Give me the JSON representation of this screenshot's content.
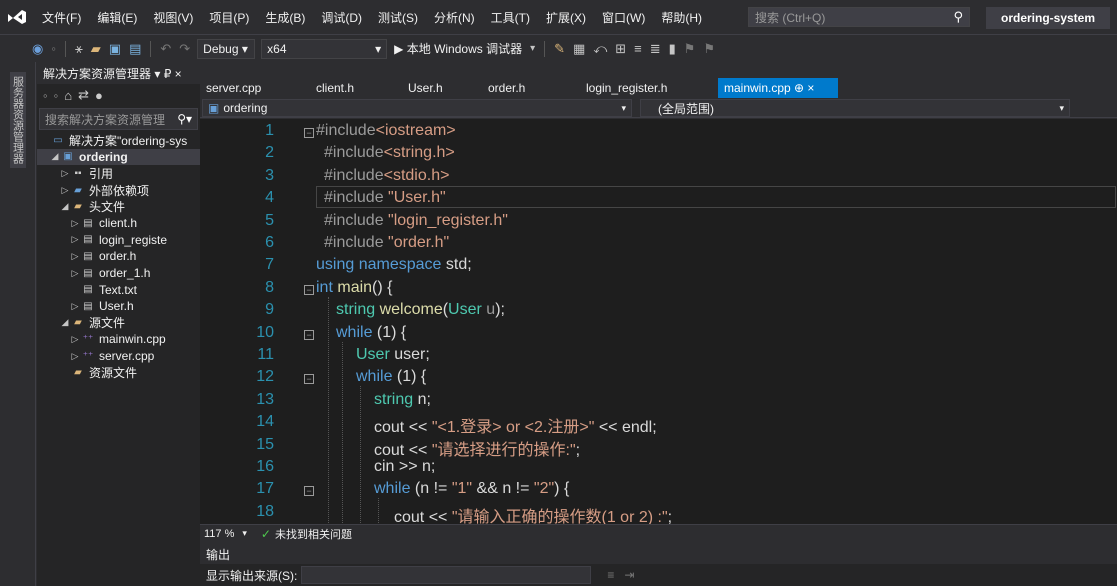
{
  "menubar": {
    "items": [
      "文件(F)",
      "编辑(E)",
      "视图(V)",
      "项目(P)",
      "生成(B)",
      "调试(D)",
      "测试(S)",
      "分析(N)",
      "工具(T)",
      "扩展(X)",
      "窗口(W)",
      "帮助(H)"
    ],
    "search_placeholder": "搜索 (Ctrl+Q)",
    "project_name": "ordering-system"
  },
  "toolbar": {
    "config": "Debug",
    "platform": "x64",
    "run_label": "▶ 本地 Windows 调试器"
  },
  "sidestrip": {
    "label": "服务器资源管理器"
  },
  "solution_explorer": {
    "title": "解决方案资源管理器 ▾ ₽ ×",
    "search_placeholder": "搜索解决方案资源管理",
    "items": [
      {
        "label": "解决方案\"ordering-sys",
        "indent": 0,
        "arrow": "",
        "icon": "solution-icon",
        "selected": false
      },
      {
        "label": "ordering",
        "indent": 1,
        "arrow": "◢",
        "icon": "project-icon",
        "selected": true
      },
      {
        "label": "引用",
        "indent": 2,
        "arrow": "▷",
        "icon": "references-icon",
        "selected": false
      },
      {
        "label": "外部依赖项",
        "indent": 2,
        "arrow": "▷",
        "icon": "external-deps-icon",
        "selected": false
      },
      {
        "label": "头文件",
        "indent": 2,
        "arrow": "◢",
        "icon": "folder-icon",
        "selected": false
      },
      {
        "label": "client.h",
        "indent": 3,
        "arrow": "▷",
        "icon": "header-file-icon",
        "selected": false
      },
      {
        "label": "login_registe",
        "indent": 3,
        "arrow": "▷",
        "icon": "header-file-icon",
        "selected": false
      },
      {
        "label": "order.h",
        "indent": 3,
        "arrow": "▷",
        "icon": "header-file-icon",
        "selected": false
      },
      {
        "label": "order_1.h",
        "indent": 3,
        "arrow": "▷",
        "icon": "header-file-icon",
        "selected": false
      },
      {
        "label": "Text.txt",
        "indent": 3,
        "arrow": "",
        "icon": "text-file-icon",
        "selected": false
      },
      {
        "label": "User.h",
        "indent": 3,
        "arrow": "▷",
        "icon": "header-file-icon",
        "selected": false
      },
      {
        "label": "源文件",
        "indent": 2,
        "arrow": "◢",
        "icon": "folder-icon",
        "selected": false
      },
      {
        "label": "mainwin.cpp",
        "indent": 3,
        "arrow": "▷",
        "icon": "cpp-file-icon",
        "selected": false
      },
      {
        "label": "server.cpp",
        "indent": 3,
        "arrow": "▷",
        "icon": "cpp-file-icon",
        "selected": false
      },
      {
        "label": "资源文件",
        "indent": 2,
        "arrow": "",
        "icon": "folder-icon",
        "selected": false
      }
    ]
  },
  "tabs": [
    {
      "label": "server.cpp",
      "active": false
    },
    {
      "label": "client.h",
      "active": false
    },
    {
      "label": "User.h",
      "active": false
    },
    {
      "label": "order.h",
      "active": false
    },
    {
      "label": "login_register.h",
      "active": false
    },
    {
      "label": "mainwin.cpp  ⊕  ×",
      "active": true
    }
  ],
  "navbar": {
    "project": "ordering",
    "scope": "(全局范围)"
  },
  "editor": {
    "lines": [
      {
        "n": "1",
        "tokens": [
          [
            "pp",
            "#include"
          ],
          [
            "str",
            "<iostream>"
          ]
        ]
      },
      {
        "n": "2",
        "tokens": [
          [
            "pp",
            "#include"
          ],
          [
            "str",
            "<string.h>"
          ]
        ]
      },
      {
        "n": "3",
        "tokens": [
          [
            "pp",
            "#include"
          ],
          [
            "str",
            "<stdio.h>"
          ]
        ]
      },
      {
        "n": "4",
        "tokens": [
          [
            "pp",
            "#include "
          ],
          [
            "str",
            "\"User.h\""
          ]
        ]
      },
      {
        "n": "5",
        "tokens": [
          [
            "pp",
            "#include "
          ],
          [
            "str",
            "\"login_register.h\""
          ]
        ]
      },
      {
        "n": "6",
        "tokens": [
          [
            "pp",
            "#include "
          ],
          [
            "str",
            "\"order.h\""
          ]
        ]
      },
      {
        "n": "7",
        "tokens": [
          [
            "kw",
            "using namespace"
          ],
          [
            "id",
            " std;"
          ]
        ]
      },
      {
        "n": "8",
        "tokens": [
          [
            "kw",
            "int"
          ],
          [
            "id",
            " "
          ],
          [
            "fn",
            "main"
          ],
          [
            "id",
            "() {"
          ]
        ]
      },
      {
        "n": "9",
        "tokens": [
          [
            "ty",
            "string"
          ],
          [
            "id",
            " "
          ],
          [
            "fn",
            "welcome"
          ],
          [
            "id",
            "("
          ],
          [
            "ty",
            "User"
          ],
          [
            "id",
            " "
          ],
          [
            "par",
            "u"
          ],
          [
            "id",
            ");"
          ]
        ]
      },
      {
        "n": "10",
        "tokens": [
          [
            "kw",
            "while"
          ],
          [
            "id",
            " (1) {"
          ]
        ]
      },
      {
        "n": "11",
        "tokens": [
          [
            "ty",
            "User"
          ],
          [
            "id",
            " user;"
          ]
        ]
      },
      {
        "n": "12",
        "tokens": [
          [
            "kw",
            "while"
          ],
          [
            "id",
            " (1) {"
          ]
        ]
      },
      {
        "n": "13",
        "tokens": [
          [
            "ty",
            "string"
          ],
          [
            "id",
            " n;"
          ]
        ]
      },
      {
        "n": "14",
        "tokens": [
          [
            "id",
            "cout << "
          ],
          [
            "str",
            "\"<1.登录> or <2.注册>\""
          ],
          [
            "id",
            " << endl;"
          ]
        ]
      },
      {
        "n": "15",
        "tokens": [
          [
            "id",
            "cout << "
          ],
          [
            "str",
            "\"请选择进行的操作:\""
          ],
          [
            "id",
            ";"
          ]
        ]
      },
      {
        "n": "16",
        "tokens": [
          [
            "id",
            "cin >> n;"
          ]
        ]
      },
      {
        "n": "17",
        "tokens": [
          [
            "kw",
            "while"
          ],
          [
            "id",
            " (n != "
          ],
          [
            "str",
            "\"1\""
          ],
          [
            "id",
            " && n != "
          ],
          [
            "str",
            "\"2\""
          ],
          [
            "id",
            ") {"
          ]
        ]
      },
      {
        "n": "18",
        "tokens": [
          [
            "id",
            "cout << "
          ],
          [
            "str",
            "\"请输入正确的操作数(1 or 2) :\""
          ],
          [
            "id",
            ";"
          ]
        ]
      }
    ]
  },
  "statusbar": {
    "zoom": "117 %",
    "issues": "未找到相关问题"
  },
  "output": {
    "title": "输出",
    "source_label": "显示输出来源(S):"
  }
}
